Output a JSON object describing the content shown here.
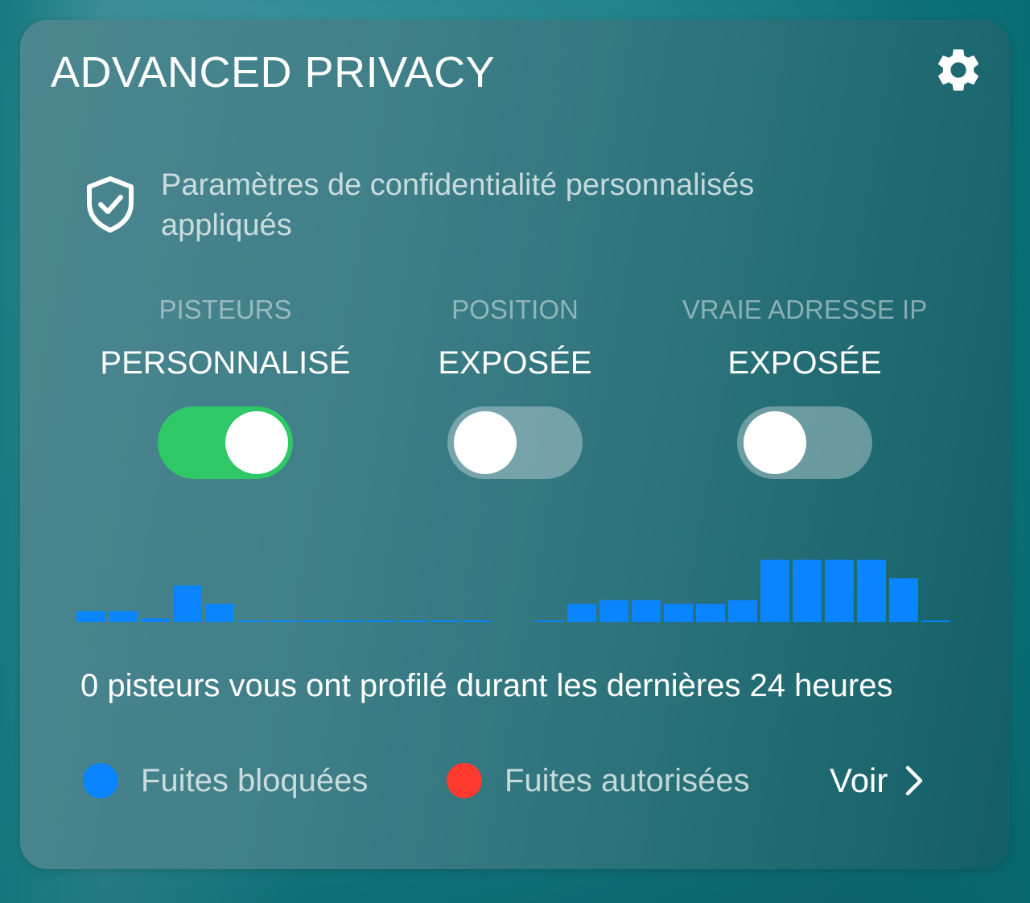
{
  "widget": {
    "title": "ADVANCED PRIVACY",
    "settings_icon": "gear-icon",
    "status_icon": "shield-check-icon",
    "status_text": "Paramètres de confidentialité personnalisés appliqués"
  },
  "toggles": [
    {
      "label": "PISTEURS",
      "value": "PERSONNALISÉ",
      "on": true
    },
    {
      "label": "POSITION",
      "value": "EXPOSÉE",
      "on": false
    },
    {
      "label": "VRAIE ADRESSE IP",
      "value": "EXPOSÉE",
      "on": false
    }
  ],
  "chart_data": {
    "type": "bar",
    "series": [
      {
        "color": "#0a84ff",
        "values": [
          3,
          3,
          1,
          10,
          5,
          0,
          0,
          0,
          0,
          0,
          0,
          0,
          0,
          0,
          5,
          6,
          6,
          5,
          5,
          6,
          17,
          17,
          17,
          17,
          12,
          0
        ]
      }
    ],
    "ylim": [
      0,
      18
    ]
  },
  "summary": "0 pisteurs vous ont profilé durant les dernières 24 heures",
  "legend": [
    {
      "label": "Fuites bloquées",
      "color": "#0a84ff"
    },
    {
      "label": "Fuites autorisées",
      "color": "#ff3b30"
    }
  ],
  "link": {
    "label": "Voir",
    "icon": "chevron-right-icon"
  },
  "colors": {
    "toggle_on": "#2ec866",
    "accent_blue": "#0a84ff",
    "accent_red": "#ff3b30"
  }
}
